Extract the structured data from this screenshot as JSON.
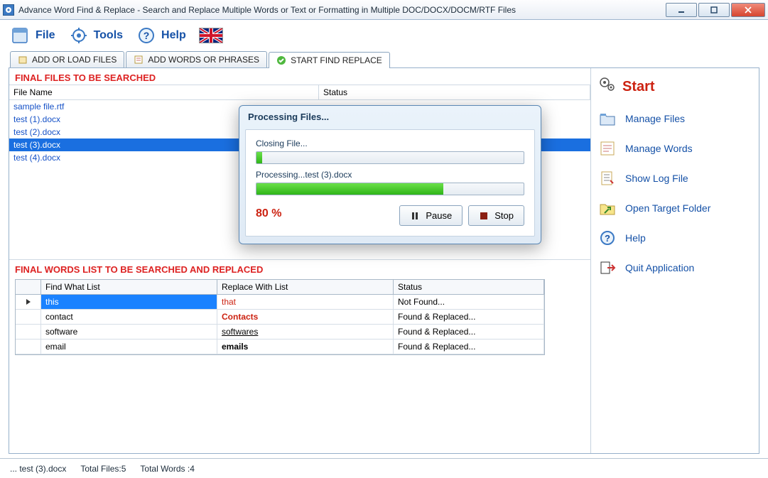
{
  "window": {
    "title": "Advance Word Find & Replace - Search and Replace Multiple Words or Text  or Formatting in Multiple DOC/DOCX/DOCM/RTF Files"
  },
  "toolbar": {
    "file": "File",
    "tools": "Tools",
    "help": "Help"
  },
  "tabs": {
    "add_files": "ADD OR LOAD FILES",
    "add_words": "ADD WORDS OR PHRASES",
    "start": "START FIND REPLACE"
  },
  "files_section": {
    "heading": "FINAL FILES TO BE SEARCHED",
    "col_file": "File Name",
    "col_status": "Status",
    "rows": [
      {
        "name": "sample file.rtf",
        "status": ""
      },
      {
        "name": "test (1).docx",
        "status": ""
      },
      {
        "name": "test (2).docx",
        "status": ""
      },
      {
        "name": "test (3).docx",
        "status": ""
      },
      {
        "name": "test (4).docx",
        "status": ""
      }
    ],
    "selected_index": 3
  },
  "words_section": {
    "heading": "FINAL WORDS LIST TO BE SEARCHED AND REPLACED",
    "col_find": "Find What List",
    "col_repl": "Replace With List",
    "col_stat": "Status",
    "rows": [
      {
        "find": "this",
        "repl": "that",
        "stat": "Not Found...",
        "repl_style": "red"
      },
      {
        "find": "contact",
        "repl": "Contacts",
        "stat": "Found & Replaced...",
        "repl_style": "red bold"
      },
      {
        "find": "software",
        "repl": "softwares",
        "stat": "Found & Replaced...",
        "repl_style": "under"
      },
      {
        "find": "email",
        "repl": "emails",
        "stat": "Found & Replaced...",
        "repl_style": "bold"
      }
    ],
    "selected_index": 0
  },
  "sidebar": {
    "start": "Start",
    "items": [
      {
        "label": "Manage Files",
        "icon": "folder"
      },
      {
        "label": "Manage Words",
        "icon": "words"
      },
      {
        "label": "Show Log File",
        "icon": "log"
      },
      {
        "label": "Open Target Folder",
        "icon": "target"
      },
      {
        "label": "Help",
        "icon": "help"
      },
      {
        "label": "Quit Application",
        "icon": "quit"
      }
    ]
  },
  "dialog": {
    "title": "Processing Files...",
    "label1": "Closing File...",
    "bar1_pct": 2,
    "label2": "Processing...test (3).docx",
    "bar2_pct": 70,
    "pct_text": "80 %",
    "pause": "Pause",
    "stop": "Stop"
  },
  "statusbar": {
    "current": "... test (3).docx",
    "total_files": "Total Files:5",
    "total_words": "Total Words :4"
  }
}
